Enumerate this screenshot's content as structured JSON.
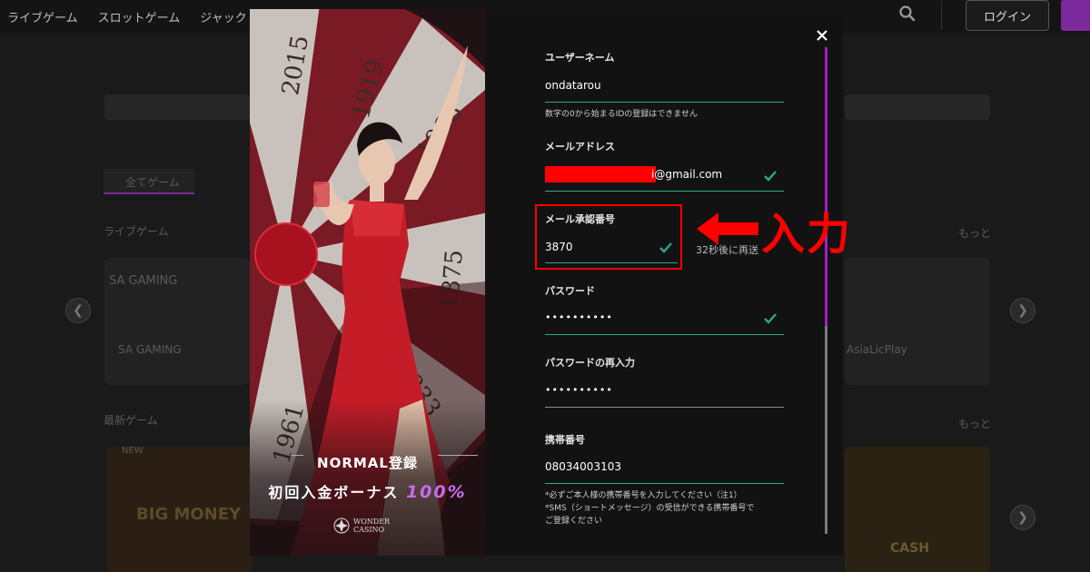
{
  "site": {
    "nav_items": [
      "ライブゲーム",
      "スロットゲーム",
      "ジャック"
    ],
    "login_label": "ログイン",
    "sections": {
      "live_games": "ライブゲーム",
      "slot_games": "最新ゲーム",
      "category_tab": "全てゲーム",
      "more_link": "もっと",
      "provider_left": "SA GAMING",
      "provider_left_caption": "SA GAMING",
      "provider_right_caption": "AsiaLicPlay",
      "game_left_title": "BIG MONEY",
      "game_right_title": "CASH",
      "new_badge": "NEW"
    }
  },
  "promo": {
    "title": "NORMAL登録",
    "bonus_text": "初回入金ボーナス",
    "bonus_percent": "100%",
    "brand_line1": "WONDER",
    "brand_line2": "CASINO",
    "wheel_numbers": [
      "2015",
      "1919",
      "1968",
      "1875",
      "1933",
      "1961"
    ]
  },
  "form": {
    "username": {
      "label": "ユーザーネーム",
      "value": "ondatarou",
      "hint": "数字の0から始まるIDの登録はできません"
    },
    "email": {
      "label": "メールアドレス",
      "value_visible": "i@gmail.com"
    },
    "verification": {
      "label": "メール承認番号",
      "value": "3870",
      "resend": "32秒後に再送"
    },
    "password": {
      "label": "パスワード",
      "value": "••••••••••"
    },
    "password_confirm": {
      "label": "パスワードの再入力",
      "value": "••••••••••"
    },
    "phone": {
      "label": "携帯番号",
      "value": "08034003103",
      "hint_lines": [
        "*必ずご本人様の携帯番号を入力してください（注1）",
        "*SMS（ショートメッセージ）の受信ができる携帯番号で",
        "ご登録ください"
      ]
    }
  },
  "annotation": {
    "text": "入力"
  },
  "colors": {
    "accent_green": "#2fa889",
    "accent_purple": "#a020c8",
    "highlight_red": "#ff0000",
    "bonus_purple": "#c56cf0"
  }
}
